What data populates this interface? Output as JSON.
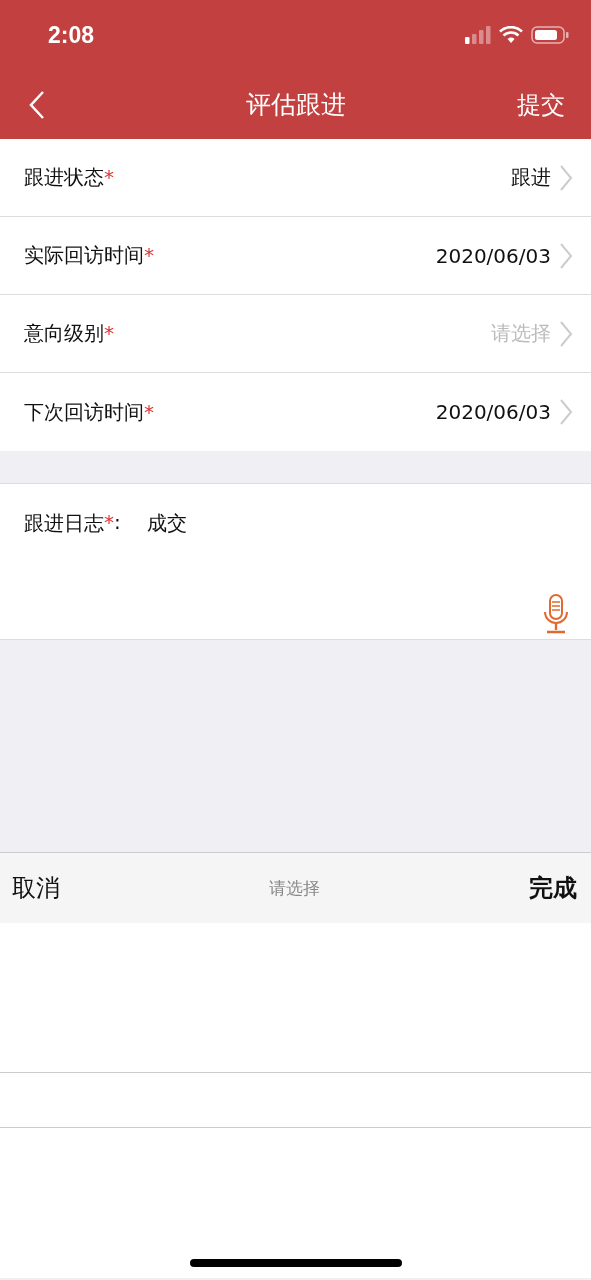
{
  "status_bar": {
    "time": "2:08"
  },
  "nav_bar": {
    "title": "评估跟进",
    "action": "提交"
  },
  "form_rows": [
    {
      "label": "跟进状态",
      "required_mark": "*",
      "value": "跟进"
    },
    {
      "label": "实际回访时间",
      "required_mark": "*",
      "value": "2020/06/03"
    },
    {
      "label": "意向级别",
      "required_mark": "*",
      "placeholder": "请选择"
    },
    {
      "label": "下次回访时间",
      "required_mark": "*",
      "value": "2020/06/03"
    }
  ],
  "log": {
    "label": "跟进日志",
    "required_mark": "*",
    "separator": ":",
    "value": "成交"
  },
  "picker": {
    "cancel": "取消",
    "title": "请选择",
    "confirm": "完成"
  }
}
